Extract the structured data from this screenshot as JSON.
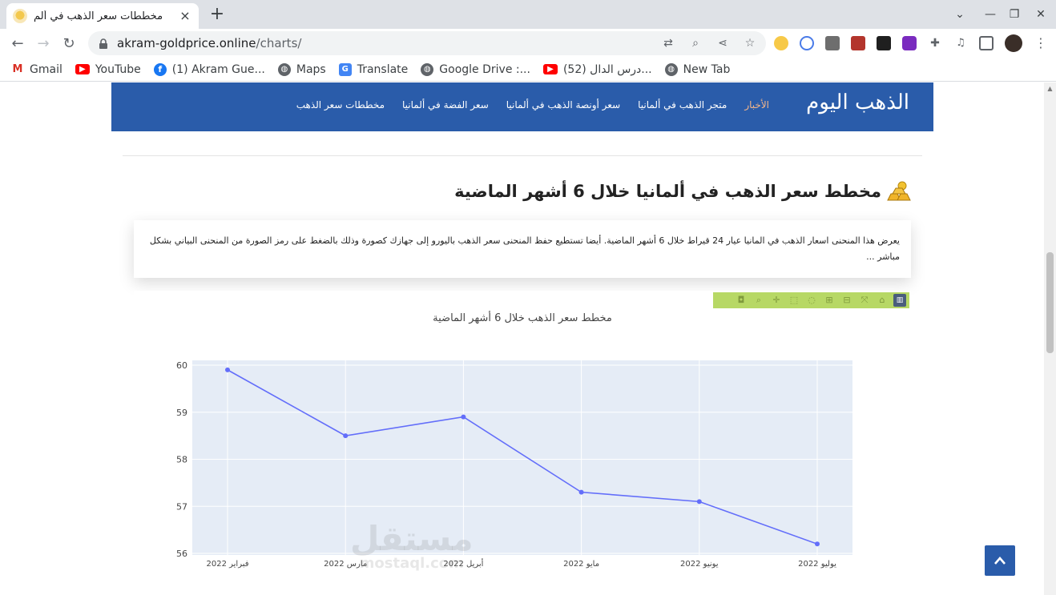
{
  "browser": {
    "tab_title": "مخططات سعر الذهب في ألم",
    "url_host": "akram-goldprice.online",
    "url_path": "/charts/",
    "bookmarks": [
      {
        "label": "Gmail",
        "icon": "gmail-icon"
      },
      {
        "label": "YouTube",
        "icon": "youtube-icon"
      },
      {
        "label": "(1) Akram Gue...",
        "icon": "facebook-icon"
      },
      {
        "label": "Maps",
        "icon": "globe-icon"
      },
      {
        "label": "Translate",
        "icon": "translate-icon"
      },
      {
        "label": "Google Drive :...",
        "icon": "globe-icon"
      },
      {
        "label": "(52) درس الدال...",
        "icon": "youtube-icon"
      },
      {
        "label": "New Tab",
        "icon": "globe-icon"
      }
    ]
  },
  "site": {
    "logo_main": "الذهب اليوم",
    "nav": [
      {
        "label": "الأخبار",
        "active": true
      },
      {
        "label": "متجر الذهب في ألمانيا",
        "active": false
      },
      {
        "label": "سعر أونصة الذهب في ألمانيا",
        "active": false
      },
      {
        "label": "سعر الفضة في ألمانيا",
        "active": false
      },
      {
        "label": "مخططات سعر الذهب",
        "active": false
      }
    ],
    "header_color": "#2a5caa"
  },
  "page": {
    "heading": "مخطط سعر الذهب في ألمانيا خلال 6 أشهر الماضية",
    "intro": "يعرض هذا المنحنى اسعار الذهب في المانيا عيار 24 قيراط خلال 6 أشهر الماضية. أيضا تستطيع حفظ المنحنى سعر الذهب باليورو إلى جهازك كصورة وذلك بالضغط على رمز الصورة من المنحنى البياني بشكل مباشر ..."
  },
  "chart_data": {
    "type": "line",
    "title": "مخطط سعر الذهب خلال 6 أشهر الماضية",
    "categories": [
      "فبراير 2022",
      "مارس 2022",
      "أبريل 2022",
      "مايو 2022",
      "يونيو 2022",
      "يوليو 2022"
    ],
    "values": [
      59.9,
      58.5,
      58.9,
      57.3,
      57.1,
      56.2
    ],
    "ylim": [
      56,
      60
    ],
    "yticks": [
      56,
      57,
      58,
      59,
      60
    ],
    "xlabel": "",
    "ylabel": "",
    "grid": true,
    "line_color": "#636efa",
    "plot_bg": "#e5ecf6"
  },
  "watermark": {
    "arabic": "مستقل",
    "latin": "mostaql.com"
  }
}
